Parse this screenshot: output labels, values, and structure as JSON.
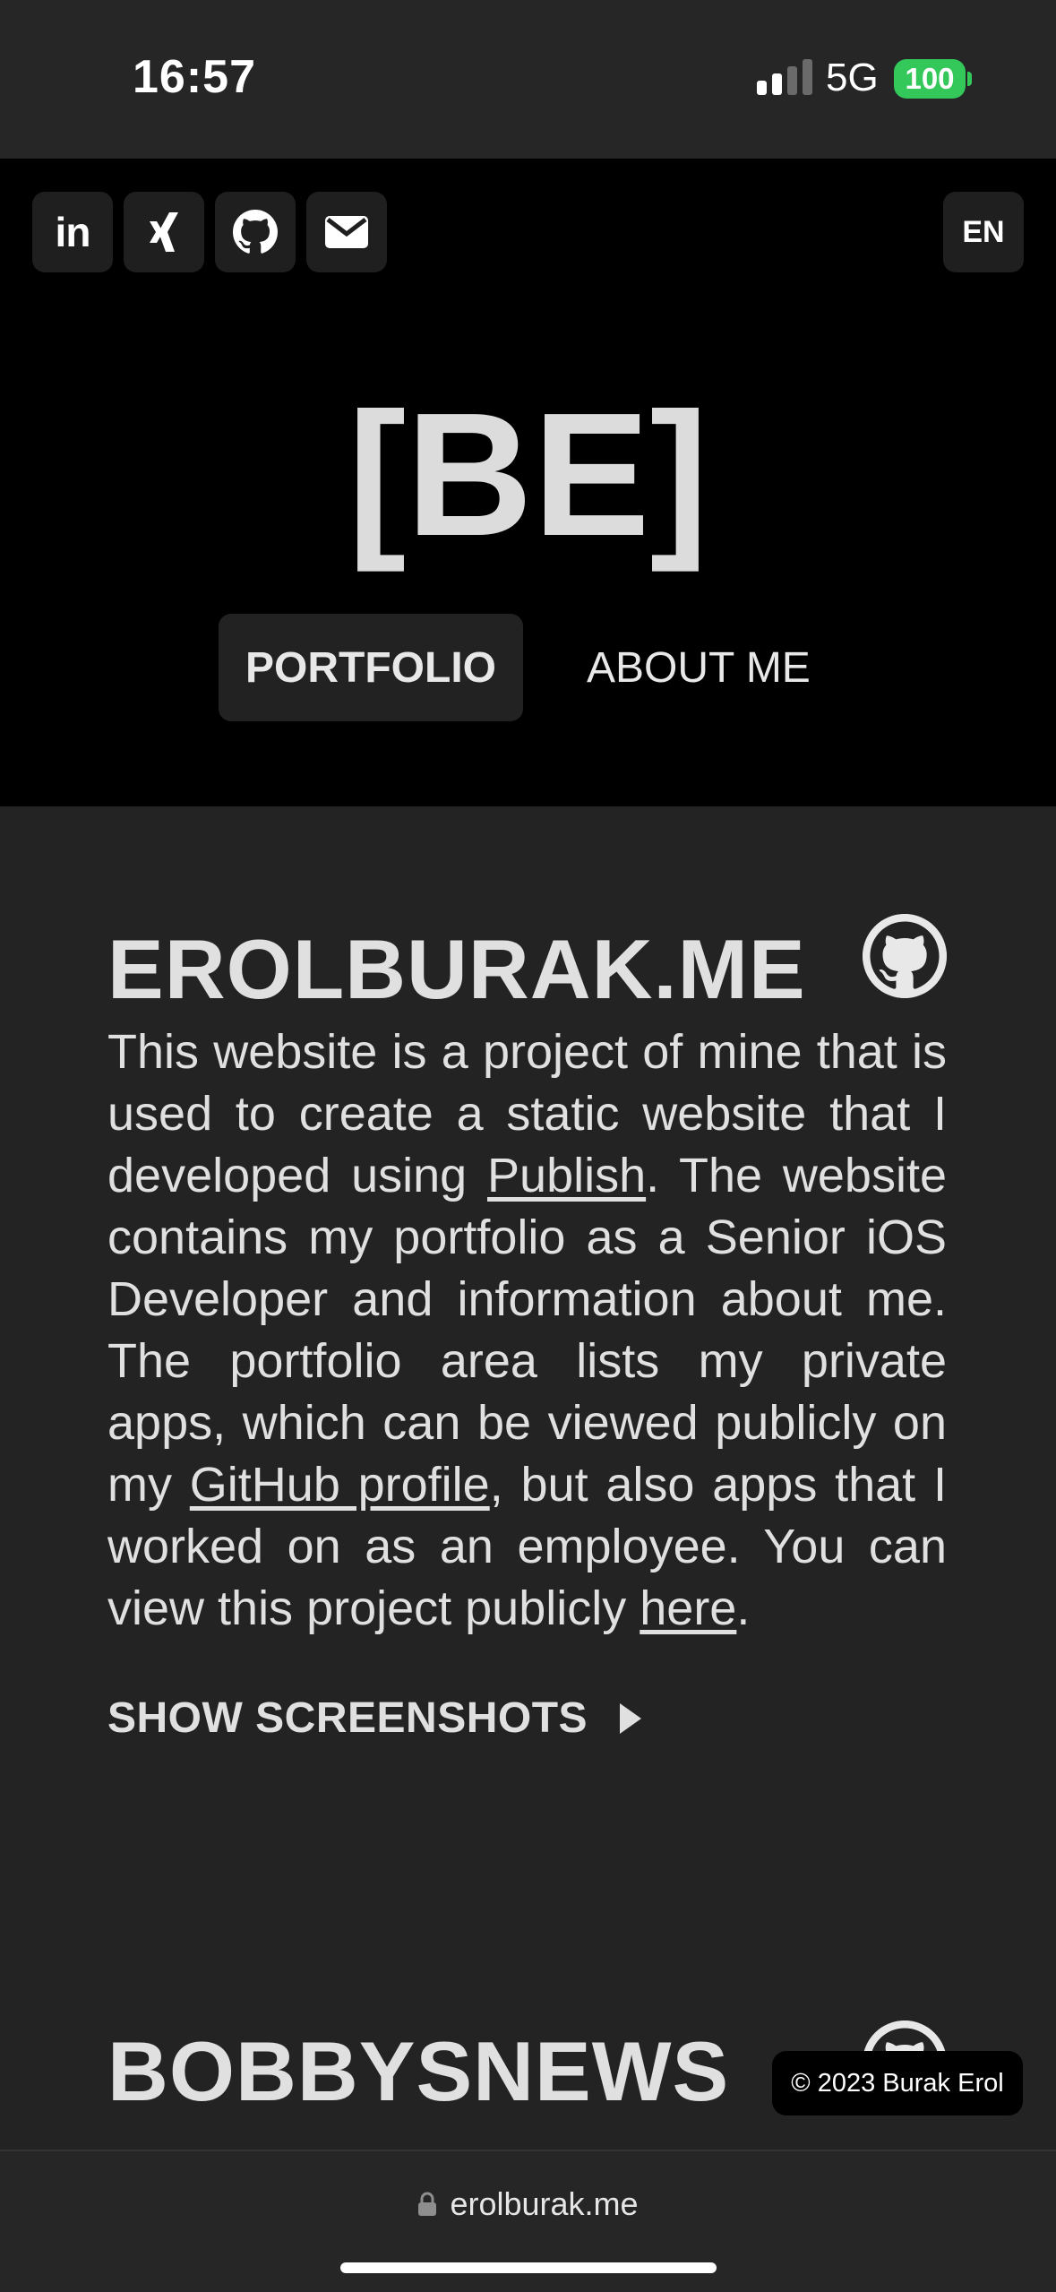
{
  "status": {
    "time": "16:57",
    "network": "5G",
    "battery": "100",
    "battery_color": "#34c759"
  },
  "header": {
    "social": [
      {
        "icon": "linkedin-icon"
      },
      {
        "icon": "xing-icon"
      },
      {
        "icon": "github-icon"
      },
      {
        "icon": "mail-icon"
      }
    ],
    "language": "EN",
    "logo": "[BE]",
    "nav": {
      "portfolio": "PORTFOLIO",
      "about": "ABOUT ME"
    }
  },
  "projects": [
    {
      "title": "EROLBURAK.ME",
      "desc_part1": "This website is a project of mine that is used to create a static website that I developed using ",
      "link1": "Publish",
      "desc_part2": ". The website contains my portfolio as a Senior iOS Developer and information about me. The portfolio area lists my private apps, which can be viewed publicly on my ",
      "link2": "GitHub profile",
      "desc_part3": ", but also apps that I worked on as an employee. You can view this project publicly ",
      "link3": "here",
      "desc_part4": ".",
      "show_screenshots": "SHOW SCREENSHOTS"
    },
    {
      "title": "BOBBYSNEWS"
    }
  ],
  "copyright": "© 2023 Burak Erol",
  "browser": {
    "url": "erolburak.me"
  }
}
